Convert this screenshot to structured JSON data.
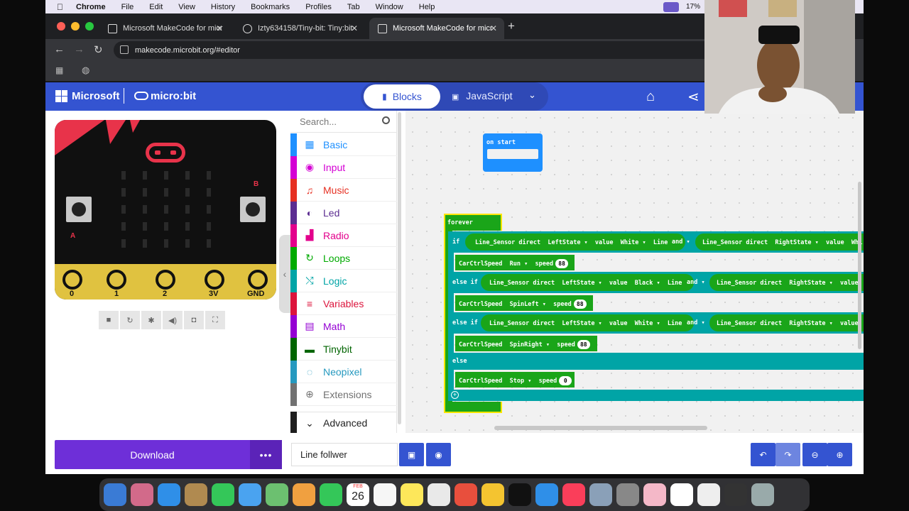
{
  "menubar": {
    "app": "Chrome",
    "items": [
      "File",
      "Edit",
      "View",
      "History",
      "Bookmarks",
      "Profiles",
      "Tab",
      "Window",
      "Help"
    ],
    "battery": "17%"
  },
  "browser": {
    "tabs": [
      {
        "title": "Microsoft MakeCode for micr"
      },
      {
        "title": "Izty634158/Tiny-bit: Tiny:bit"
      },
      {
        "title": "Microsoft MakeCode for micr"
      }
    ],
    "url": "makecode.microbit.org/#editor"
  },
  "header": {
    "brand": "Microsoft",
    "product": "micro:bit",
    "mode_blocks": "Blocks",
    "mode_js": "JavaScript"
  },
  "simulator": {
    "pins": [
      "0",
      "1",
      "2",
      "3V",
      "GND"
    ],
    "button_a": "A",
    "button_b": "B"
  },
  "toolbox": {
    "search_placeholder": "Search...",
    "categories": [
      {
        "label": "Basic",
        "color": "#1e90ff",
        "icon": "grid-icon"
      },
      {
        "label": "Input",
        "color": "#d400d4",
        "icon": "target-icon"
      },
      {
        "label": "Music",
        "color": "#e63022",
        "icon": "headphones-icon"
      },
      {
        "label": "Led",
        "color": "#5c2d91",
        "icon": "toggle-icon"
      },
      {
        "label": "Radio",
        "color": "#e3008c",
        "icon": "signal-icon"
      },
      {
        "label": "Loops",
        "color": "#00aa00",
        "icon": "loop-icon"
      },
      {
        "label": "Logic",
        "color": "#00a4a6",
        "icon": "shuffle-icon"
      },
      {
        "label": "Variables",
        "color": "#dc143c",
        "icon": "lines-icon"
      },
      {
        "label": "Math",
        "color": "#9400d3",
        "icon": "calculator-icon"
      },
      {
        "label": "Tinybit",
        "color": "#006400",
        "icon": "car-icon"
      },
      {
        "label": "Neopixel",
        "color": "#2699bf",
        "icon": "dots-circle-icon"
      },
      {
        "label": "Extensions",
        "color": "#717171",
        "icon": "plus-circle-icon"
      }
    ],
    "advanced": "Advanced"
  },
  "workspace": {
    "on_start": "on start",
    "forever": "forever",
    "if": "if",
    "else_if": "else if",
    "else": "else",
    "and": "and",
    "line1": {
      "sensor": "Line_Sensor direct",
      "left": "LeftState",
      "value": "value",
      "color_l": "White",
      "line": "Line",
      "right": "RightState",
      "color_r": "Whi"
    },
    "line2": {
      "color_l": "Black"
    },
    "line3": {
      "color_l": "White"
    },
    "speed_cmd": "CarCtrlSpeed",
    "run": "Run",
    "spinleft": "SpinLeft",
    "spinright": "SpinRight",
    "stop": "Stop",
    "speed": "speed",
    "val88": "88",
    "val0": "0"
  },
  "bottom": {
    "download": "Download",
    "more": "•••",
    "project_name": "Line follwer"
  },
  "dock": {
    "calendar_month": "FEB",
    "calendar_day": "26"
  }
}
